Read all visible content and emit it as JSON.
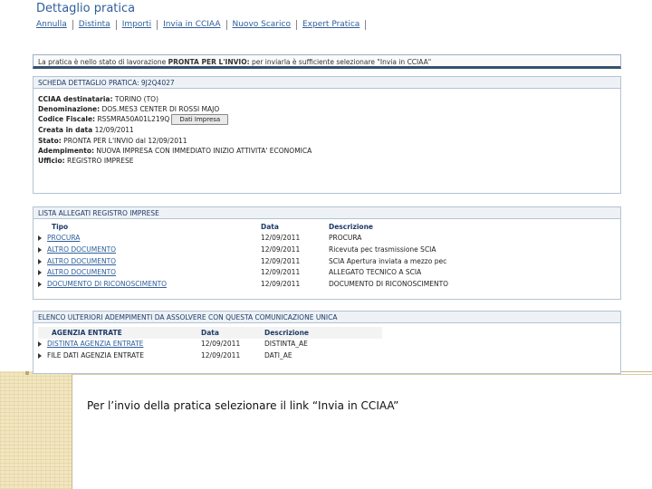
{
  "header": {
    "title": "Dettaglio pratica",
    "menu": [
      "Annulla",
      "Distinta",
      "Importi",
      "Invia in CCIAA",
      "Nuovo Scarico",
      "Expert Pratica"
    ]
  },
  "status": {
    "prefix": "La pratica è nello stato di lavorazione ",
    "state": "PRONTA PER L'INVIO:",
    "suffix": " per inviarla è sufficiente selezionare \"Invia in CCIAA\""
  },
  "detail": {
    "heading": "SCHEDA DETTAGLIO PRATICA: 9J2Q4027",
    "fields": [
      {
        "label": "CCIAA destinataria:",
        "value": " TORINO (TO)"
      },
      {
        "label": "Denominazione:",
        "value": " DOS.MES3 CENTER DI ROSSI MAJO"
      },
      {
        "label": "Codice Fiscale:",
        "value": " RSSMRA50A01L219Q"
      },
      {
        "label": "Creata in data",
        "value": " 12/09/2011"
      },
      {
        "label": "Stato:",
        "value": " PRONTA PER L'INVIO dal 12/09/2011"
      },
      {
        "label": "Adempimento:",
        "value": " NUOVA IMPRESA CON IMMEDIATO INIZIO ATTIVITA' ECONOMICA"
      },
      {
        "label": "Ufficio:",
        "value": " REGISTRO IMPRESE"
      }
    ],
    "company_button": "Dati Impresa"
  },
  "attachments": {
    "heading": "LISTA ALLEGATI REGISTRO IMPRESE",
    "columns": [
      "Tipo",
      "Data",
      "Descrizione"
    ],
    "rows": [
      {
        "tipo": "PROCURA",
        "data": "12/09/2011",
        "descr": "PROCURA"
      },
      {
        "tipo": "ALTRO DOCUMENTO",
        "data": "12/09/2011",
        "descr": "Ricevuta pec trasmissione SCIA"
      },
      {
        "tipo": "ALTRO DOCUMENTO",
        "data": "12/09/2011",
        "descr": "SCIA Apertura inviata a mezzo pec"
      },
      {
        "tipo": "ALTRO DOCUMENTO",
        "data": "12/09/2011",
        "descr": "ALLEGATO TECNICO A SCIA"
      },
      {
        "tipo": "DOCUMENTO DI RICONOSCIMENTO",
        "data": "12/09/2011",
        "descr": "DOCUMENTO DI RICONOSCIMENTO"
      }
    ]
  },
  "adempimenti": {
    "heading": "ELENCO ULTERIORI ADEMPIMENTI DA ASSOLVERE CON QUESTA COMUNICAZIONE UNICA",
    "columns": [
      "AGENZIA ENTRATE",
      "Data",
      "Descrizione"
    ],
    "rows": [
      {
        "tipo": "DISTINTA AGENZIA ENTRATE",
        "data": "12/09/2011",
        "descr": "DISTINTA_AE"
      },
      {
        "tipo": "FILE DATI AGENZIA ENTRATE",
        "data": "12/09/2011",
        "descr": "DATI_AE"
      }
    ]
  },
  "caption": "Per l’invio della pratica selezionare il link “Invia in CCIAA”"
}
